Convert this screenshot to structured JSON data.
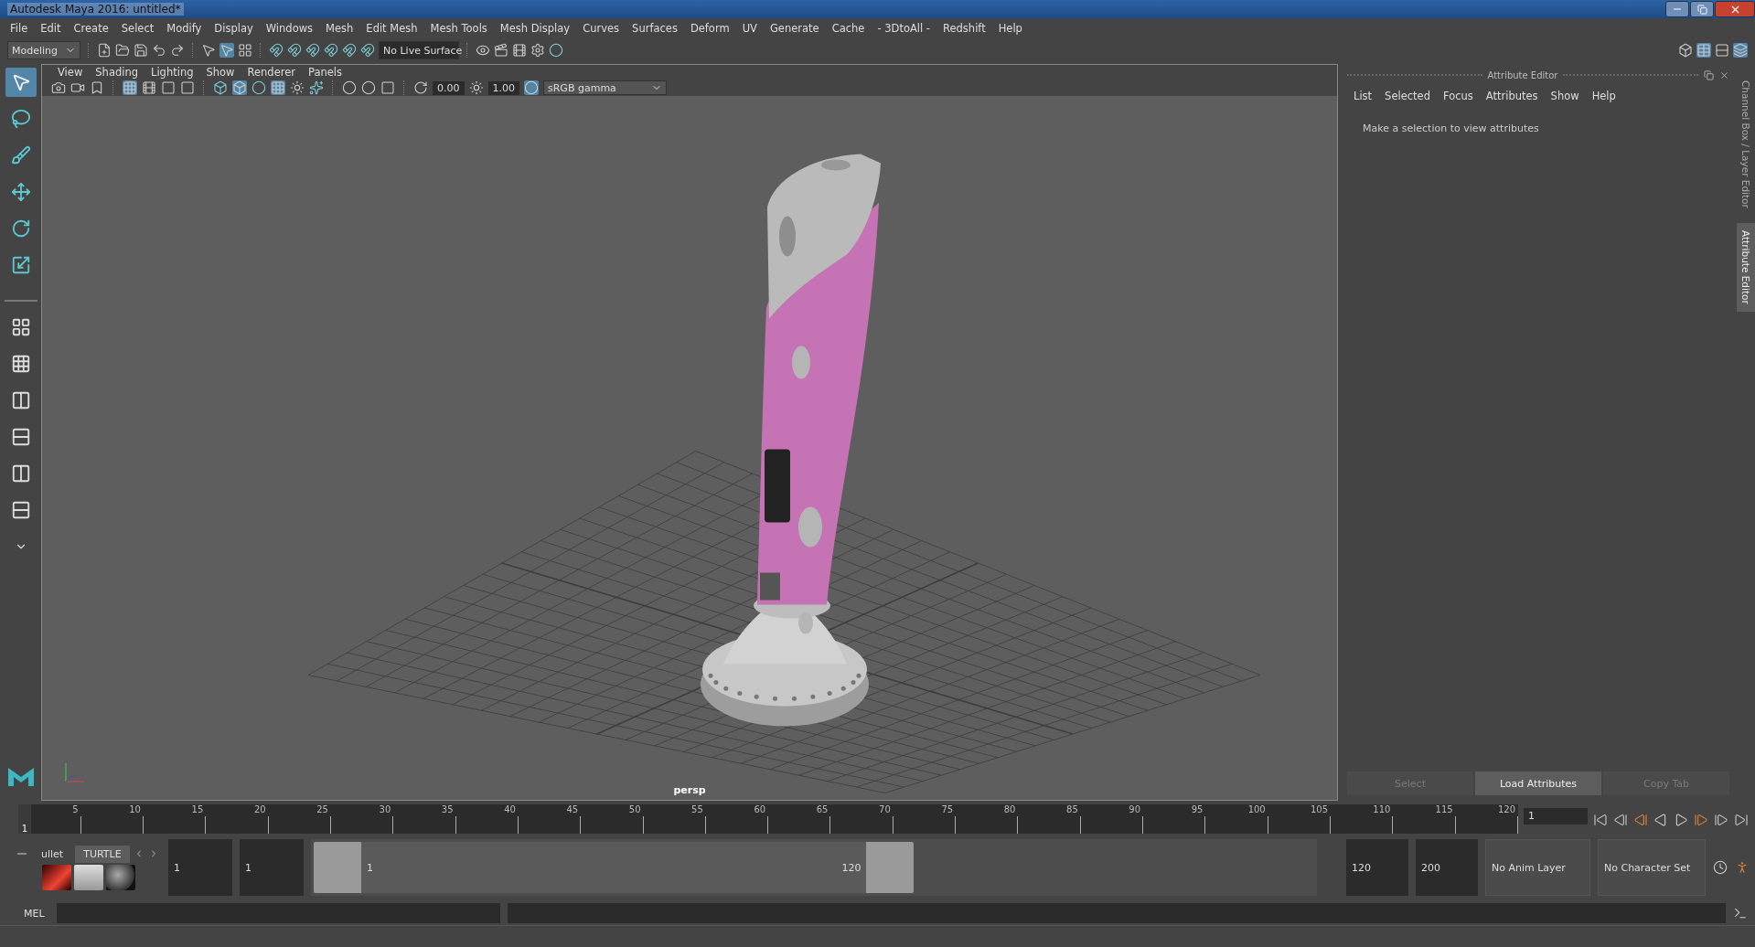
{
  "window": {
    "title": "Autodesk Maya 2016: untitled*"
  },
  "menu_bar": [
    "File",
    "Edit",
    "Create",
    "Select",
    "Modify",
    "Display",
    "Windows",
    "Mesh",
    "Edit Mesh",
    "Mesh Tools",
    "Mesh Display",
    "Curves",
    "Surfaces",
    "Deform",
    "UV",
    "Generate",
    "Cache",
    "- 3DtoAll -",
    "Redshift",
    "Help"
  ],
  "status_line": {
    "mode": "Modeling",
    "live_surface": "No Live Surface"
  },
  "viewport": {
    "menu": [
      "View",
      "Shading",
      "Lighting",
      "Show",
      "Renderer",
      "Panels"
    ],
    "exposure": "0.00",
    "gamma": "1.00",
    "color_space": "sRGB gamma",
    "camera": "persp"
  },
  "attribute_editor": {
    "title": "Attribute Editor",
    "menu": [
      "List",
      "Selected",
      "Focus",
      "Attributes",
      "Show",
      "Help"
    ],
    "message": "Make a selection to view attributes",
    "buttons": [
      {
        "label": "Select",
        "disabled": true
      },
      {
        "label": "Load Attributes",
        "disabled": false
      },
      {
        "label": "Copy Tab",
        "disabled": true
      }
    ]
  },
  "side_tabs": [
    {
      "label": "Channel Box / Layer Editor",
      "selected": false
    },
    {
      "label": "Attribute Editor",
      "selected": true
    }
  ],
  "timeline": {
    "ticks": [
      "5",
      "10",
      "15",
      "20",
      "25",
      "30",
      "35",
      "40",
      "45",
      "50",
      "55",
      "60",
      "65",
      "70",
      "75",
      "80",
      "85",
      "90",
      "95",
      "100",
      "105",
      "110",
      "115",
      "120"
    ],
    "current": "1",
    "level": 0,
    "current_frame": "1"
  },
  "shelf_tabs": [
    {
      "label": "ullet",
      "selected": false
    },
    {
      "label": "TURTLE",
      "selected": true
    }
  ],
  "range": {
    "start": "1",
    "playback_start": "1",
    "slider_start": "1",
    "slider_end": "120",
    "level": 0.6,
    "playback_end": "120",
    "end": "200",
    "anim_layer": "No Anim Layer",
    "character_set": "No Character Set"
  },
  "command_line": {
    "language": "MEL"
  }
}
